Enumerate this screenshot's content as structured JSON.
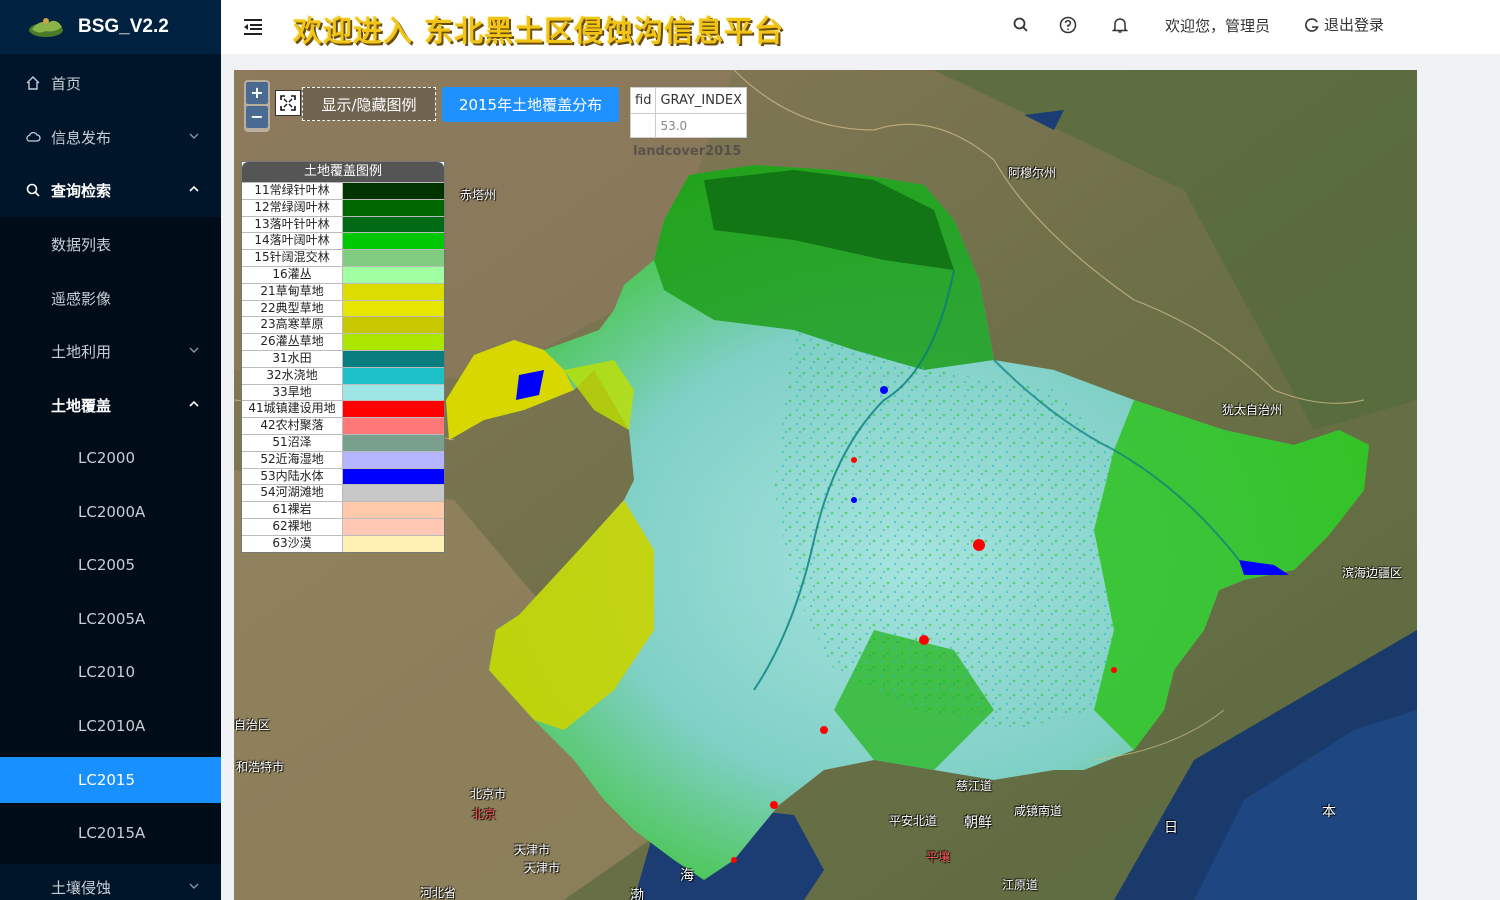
{
  "app": {
    "name": "BSG_V2.2"
  },
  "header": {
    "title": "欢迎进入 东北黑土区侵蚀沟信息平台",
    "welcome": "欢迎您，管理员",
    "logout": "退出登录"
  },
  "sidebar": {
    "items": [
      {
        "label": "首页",
        "icon": "home-icon"
      },
      {
        "label": "信息发布",
        "icon": "cloud-icon",
        "expandable": true
      },
      {
        "label": "查询检索",
        "icon": "search-icon",
        "expanded": true
      },
      {
        "label": "数据列表"
      },
      {
        "label": "遥感影像"
      },
      {
        "label": "土地利用",
        "expandable": true
      },
      {
        "label": "土地覆盖",
        "expanded": true
      },
      {
        "label": "LC2000"
      },
      {
        "label": "LC2000A"
      },
      {
        "label": "LC2005"
      },
      {
        "label": "LC2005A"
      },
      {
        "label": "LC2010"
      },
      {
        "label": "LC2010A"
      },
      {
        "label": "LC2015",
        "active": true
      },
      {
        "label": "LC2015A"
      },
      {
        "label": "土壤侵蚀",
        "expandable": true
      }
    ]
  },
  "map": {
    "zoom_in": "+",
    "zoom_out": "−",
    "legend_toggle": "显示/隐藏图例",
    "layer_button": "2015年土地覆盖分布",
    "attr_table": {
      "headers": [
        "fid",
        "GRAY_INDEX"
      ],
      "row": [
        "",
        "53.0"
      ]
    },
    "layer_name": "landcover2015",
    "place_labels": [
      "赤塔州",
      "阿穆尔州",
      "犹太自治州",
      "滨海边疆区",
      "自治区",
      "和浩特市",
      "北京市",
      "北京",
      "天津市",
      "天津市",
      "河北省",
      "慈江道",
      "平安北道",
      "朝鲜",
      "咸镜南道",
      "平壤",
      "江原道",
      "海",
      "渤",
      "日",
      "本"
    ],
    "legend": {
      "title": "土地覆盖图例",
      "items": [
        {
          "label": "11常绿针叶林",
          "color": "#003300"
        },
        {
          "label": "12常绿阔叶林",
          "color": "#006600"
        },
        {
          "label": "13落叶针叶林",
          "color": "#006a16"
        },
        {
          "label": "14落叶阔叶林",
          "color": "#00c800"
        },
        {
          "label": "15针阔混交林",
          "color": "#80cc80"
        },
        {
          "label": "16灌丛",
          "color": "#a0ffa0"
        },
        {
          "label": "21草甸草地",
          "color": "#dcdc00"
        },
        {
          "label": "22典型草地",
          "color": "#e6e600"
        },
        {
          "label": "23高寒草原",
          "color": "#c8c800"
        },
        {
          "label": "26灌丛草地",
          "color": "#aae600"
        },
        {
          "label": "31水田",
          "color": "#087d80"
        },
        {
          "label": "32水浇地",
          "color": "#1ec0c8"
        },
        {
          "label": "33旱地",
          "color": "#9ee6e6"
        },
        {
          "label": "41城镇建设用地",
          "color": "#ff0000"
        },
        {
          "label": "42农村聚落",
          "color": "#ff7878"
        },
        {
          "label": "51沼泽",
          "color": "#78a08c"
        },
        {
          "label": "52近海湿地",
          "color": "#b4b4ff"
        },
        {
          "label": "53内陆水体",
          "color": "#0000ff"
        },
        {
          "label": "54河湖滩地",
          "color": "#c8c8c8"
        },
        {
          "label": "61裸岩",
          "color": "#ffc8aa"
        },
        {
          "label": "62裸地",
          "color": "#ffc8b4"
        },
        {
          "label": "63沙漠",
          "color": "#fff0b4"
        }
      ]
    }
  }
}
